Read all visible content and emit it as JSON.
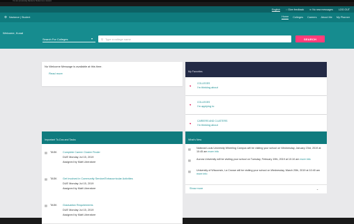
{
  "top_notice": "You are previewing Naviance Student as a student",
  "utility_bar": {
    "language": "English",
    "feedback": "Give feedback",
    "messages": "No new messages",
    "logout": "LOG OUT"
  },
  "brand": "Naviance | Student",
  "nav": {
    "items": [
      "Home",
      "Colleges",
      "Careers",
      "About Me",
      "My Planner"
    ],
    "active": "Home"
  },
  "hero": {
    "welcome": "Welcome, Kunal",
    "search_for_label": "Search For Colleges",
    "college_placeholder": "Type a college name",
    "search_button": "SEARCH"
  },
  "welcome_card": {
    "message": "No Welcome Message is available at this time.",
    "read_more": "Read more"
  },
  "favorites": {
    "title": "My Favorites",
    "items": [
      {
        "category": "COLLEGES",
        "label": "I'm thinking about"
      },
      {
        "category": "COLLEGES",
        "label": "I'm applying to"
      },
      {
        "category": "CAREERS AND CLUSTERS",
        "label": "I'm thinking about"
      }
    ]
  },
  "tasks": {
    "title": "Important To-Dos and Tasks",
    "items": [
      {
        "label": "TASK",
        "title": "Complete Career Cluster Finder",
        "due": "DUE   Monday Jul 15, 2019",
        "assigned": "Assigned by Matt Liberatore"
      },
      {
        "label": "TASK",
        "title": "Get Involved in Community Service/Extracurricular Activities",
        "due": "DUE   Monday Jul 15, 2019",
        "assigned": "Assigned by Matt Liberatore"
      },
      {
        "label": "TASK",
        "title": "Graduation Requirements",
        "due": "DUE   Monday Jul 15, 2019",
        "assigned": "Assigned by Matt Liberatore"
      }
    ]
  },
  "whats_new": {
    "title": "What's New",
    "more_info": "more info",
    "items": [
      {
        "text": "National Louis University Wheeling Campus will be visiting your school on Wednesday, January 23rd, 2019 at 10:45 am"
      },
      {
        "text": "Aurora University will be visiting your school on Tuesday, February 19th, 2019 at 10:10 am"
      },
      {
        "text": "University of Wisconsin, La Crosse will be visiting your school on Wednesday, March 20th, 2019 at 10:40 am"
      }
    ],
    "show_more": "Show more"
  }
}
